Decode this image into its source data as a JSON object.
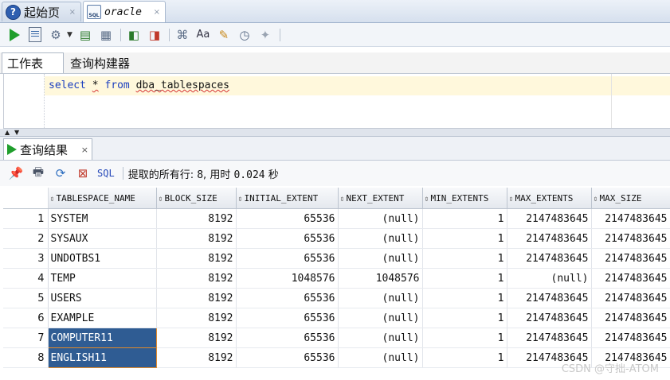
{
  "top_tabs": [
    {
      "label": "起始页",
      "icon": "help-icon",
      "close": "×"
    },
    {
      "label": "oracle",
      "icon": "sql-file-icon",
      "close": "×"
    }
  ],
  "toolbar": {
    "buttons": [
      "run-statement-icon",
      "run-script-icon",
      "commit-icon",
      "rollback-icon",
      "explain-plan-icon",
      "autotrace-icon",
      "sql-tuning-icon",
      "tune-icon",
      "format-icon",
      "clear-icon",
      "history-icon",
      "monitor-icon"
    ],
    "sql_icon_text": "SQL"
  },
  "worksheet_tabs": [
    "工作表",
    "查询构建器"
  ],
  "editor": {
    "kw1": "select",
    "star": "*",
    "kw2": "from",
    "table": "dba_tablespaces"
  },
  "results": {
    "tab_label": "查询结果",
    "tab_close": "×",
    "sql_label": "SQL",
    "status_prefix": "提取的所有行:",
    "row_count": "8",
    "time_label": "用时",
    "time_value": "0.024",
    "time_unit": "秒",
    "columns": [
      "TABLESPACE_NAME",
      "BLOCK_SIZE",
      "INITIAL_EXTENT",
      "NEXT_EXTENT",
      "MIN_EXTENTS",
      "MAX_EXTENTS",
      "MAX_SIZE"
    ],
    "rows": [
      {
        "n": "1",
        "name": "SYSTEM",
        "block": "8192",
        "initial": "65536",
        "next": "(null)",
        "min": "1",
        "max_ext": "2147483645",
        "max_size": "2147483645"
      },
      {
        "n": "2",
        "name": "SYSAUX",
        "block": "8192",
        "initial": "65536",
        "next": "(null)",
        "min": "1",
        "max_ext": "2147483645",
        "max_size": "2147483645"
      },
      {
        "n": "3",
        "name": "UNDOTBS1",
        "block": "8192",
        "initial": "65536",
        "next": "(null)",
        "min": "1",
        "max_ext": "2147483645",
        "max_size": "2147483645"
      },
      {
        "n": "4",
        "name": "TEMP",
        "block": "8192",
        "initial": "1048576",
        "next": "1048576",
        "min": "1",
        "max_ext": "(null)",
        "max_size": "2147483645"
      },
      {
        "n": "5",
        "name": "USERS",
        "block": "8192",
        "initial": "65536",
        "next": "(null)",
        "min": "1",
        "max_ext": "2147483645",
        "max_size": "2147483645"
      },
      {
        "n": "6",
        "name": "EXAMPLE",
        "block": "8192",
        "initial": "65536",
        "next": "(null)",
        "min": "1",
        "max_ext": "2147483645",
        "max_size": "2147483645"
      },
      {
        "n": "7",
        "name": "COMPUTER11",
        "block": "8192",
        "initial": "65536",
        "next": "(null)",
        "min": "1",
        "max_ext": "2147483645",
        "max_size": "2147483645"
      },
      {
        "n": "8",
        "name": "ENGLISH11",
        "block": "8192",
        "initial": "65536",
        "next": "(null)",
        "min": "1",
        "max_ext": "2147483645",
        "max_size": "2147483645"
      }
    ]
  },
  "watermark": "CSDN @守拙-ATOM",
  "colors": {
    "selection": "#2f5c93",
    "keyword": "#1c3fbf",
    "run": "#1f9e2c",
    "current_line": "#fff8dc"
  }
}
